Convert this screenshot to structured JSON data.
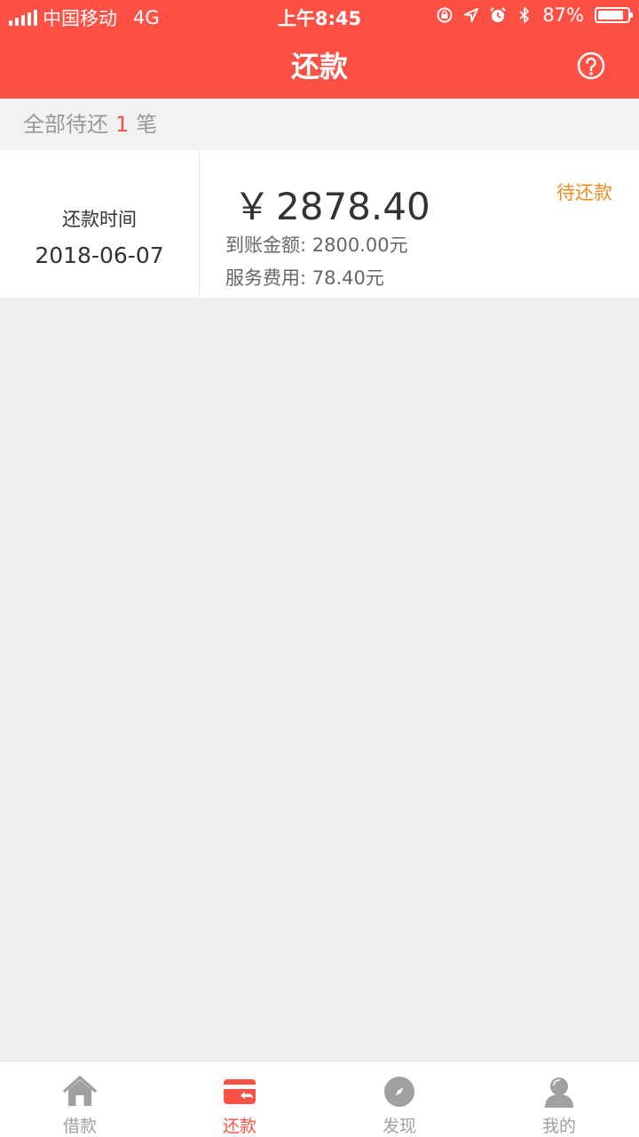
{
  "status_bar": {
    "carrier": "中国移动",
    "network": "4G",
    "time": "上午8:45",
    "battery": "87%",
    "battery_level": 0.87,
    "icons": [
      "signal-icon",
      "rotation-lock-icon",
      "location-icon",
      "alarm-icon",
      "bluetooth-icon",
      "battery-icon"
    ]
  },
  "nav": {
    "title": "还款",
    "help_icon": "help-icon"
  },
  "summary": {
    "prefix": "全部待还",
    "count": "1",
    "suffix": "笔"
  },
  "repayments": [
    {
      "time_label": "还款时间",
      "date": "2018-06-07",
      "currency": "￥",
      "amount": "2878.40",
      "received": "到账金额: 2800.00元",
      "fee": "服务费用: 78.40元",
      "status": "待还款"
    }
  ],
  "tabs": [
    {
      "label": "借款",
      "icon": "home-icon",
      "active": false
    },
    {
      "label": "还款",
      "icon": "repay-card-icon",
      "active": true
    },
    {
      "label": "发现",
      "icon": "compass-icon",
      "active": false
    },
    {
      "label": "我的",
      "icon": "user-icon",
      "active": false
    }
  ],
  "colors": {
    "brand": "#fd5145",
    "status_pending": "#f08b1d",
    "tab_inactive": "#a0a0a0"
  }
}
